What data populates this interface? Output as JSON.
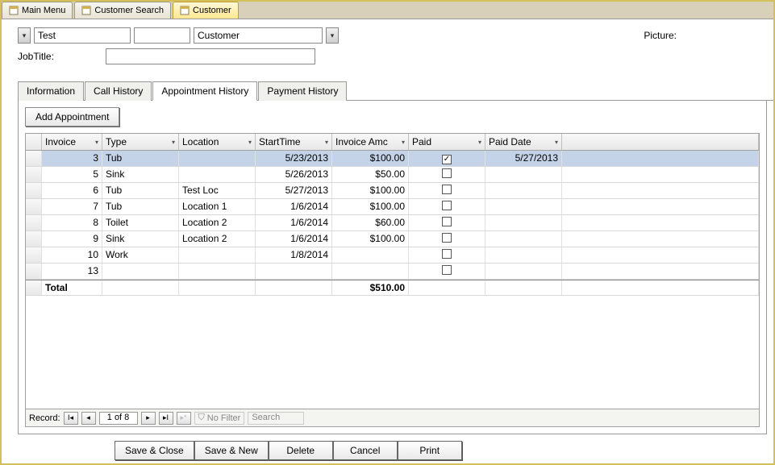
{
  "nav_tabs": [
    {
      "label": "Main Menu",
      "active": false
    },
    {
      "label": "Customer Search",
      "active": false
    },
    {
      "label": "Customer",
      "active": true
    }
  ],
  "form": {
    "first_name": "Test",
    "last_name": "Customer",
    "jobtitle_label": "JobTitle:",
    "jobtitle_value": "",
    "picture_label": "Picture:"
  },
  "inner_tabs": [
    {
      "label": "Information",
      "active": false
    },
    {
      "label": "Call History",
      "active": false
    },
    {
      "label": "Appointment History",
      "active": true
    },
    {
      "label": "Payment History",
      "active": false
    }
  ],
  "panel": {
    "add_button": "Add Appointment",
    "columns": [
      "Invoice",
      "Type",
      "Location",
      "StartTime",
      "Invoice Amc",
      "Paid",
      "Paid Date"
    ],
    "rows": [
      {
        "invoice": "3",
        "type": "Tub",
        "location": "",
        "start": "5/23/2013",
        "amt": "$100.00",
        "paid": true,
        "paiddate": "5/27/2013",
        "selected": true
      },
      {
        "invoice": "5",
        "type": "Sink",
        "location": "",
        "start": "5/26/2013",
        "amt": "$50.00",
        "paid": false,
        "paiddate": ""
      },
      {
        "invoice": "6",
        "type": "Tub",
        "location": "Test Loc",
        "start": "5/27/2013",
        "amt": "$100.00",
        "paid": false,
        "paiddate": ""
      },
      {
        "invoice": "7",
        "type": "Tub",
        "location": "Location 1",
        "start": "1/6/2014",
        "amt": "$100.00",
        "paid": false,
        "paiddate": ""
      },
      {
        "invoice": "8",
        "type": "Toilet",
        "location": "Location 2",
        "start": "1/6/2014",
        "amt": "$60.00",
        "paid": false,
        "paiddate": ""
      },
      {
        "invoice": "9",
        "type": "Sink",
        "location": "Location 2",
        "start": "1/6/2014",
        "amt": "$100.00",
        "paid": false,
        "paiddate": ""
      },
      {
        "invoice": "10",
        "type": "Work",
        "location": "",
        "start": "1/8/2014",
        "amt": "",
        "paid": false,
        "paiddate": ""
      },
      {
        "invoice": "13",
        "type": "",
        "location": "",
        "start": "",
        "amt": "",
        "paid": false,
        "paiddate": ""
      }
    ],
    "total_label": "Total",
    "total_amt": "$510.00"
  },
  "record_nav": {
    "label": "Record:",
    "position": "1 of 8",
    "no_filter": "No Filter",
    "search": "Search"
  },
  "footer_buttons": [
    "Save & Close",
    "Save & New",
    "Delete",
    "Cancel",
    "Print"
  ]
}
